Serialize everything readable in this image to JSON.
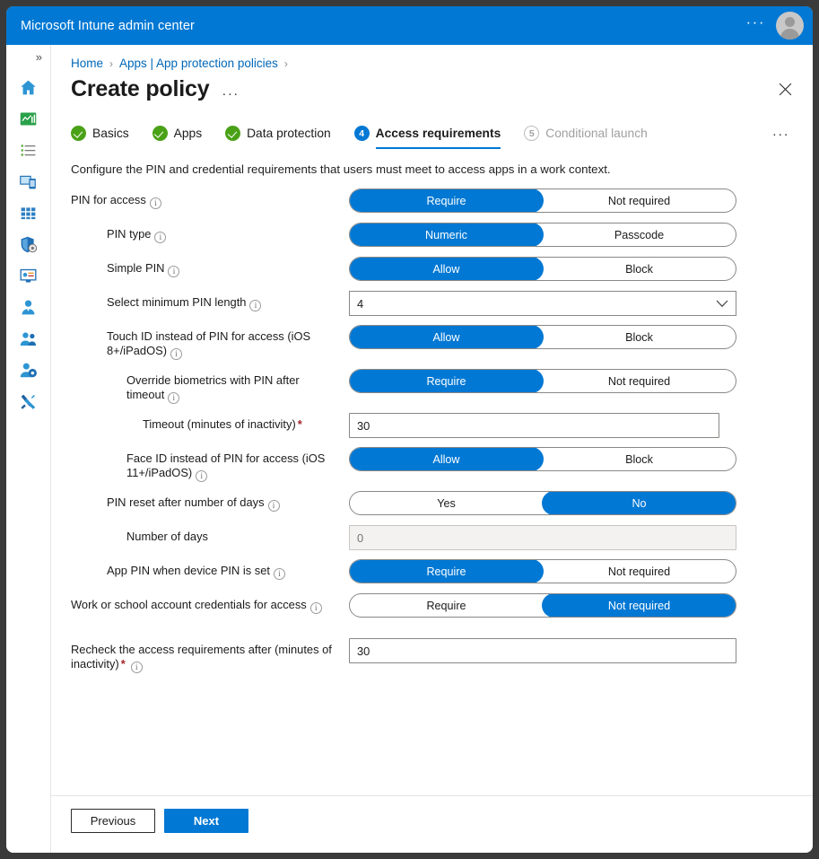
{
  "titlebar": {
    "app_title": "Microsoft Intune admin center",
    "ellipsis": "···",
    "avatar_name": "avatar"
  },
  "rail": {
    "toggle": "»",
    "icons": [
      "home-icon",
      "dashboard-icon",
      "all-services-icon",
      "devices-icon",
      "apps-icon",
      "endpoint-security-icon",
      "reports-icon",
      "users-icon",
      "groups-icon",
      "tenant-administration-icon",
      "troubleshooting-support-icon"
    ]
  },
  "breadcrumb": {
    "items": [
      "Home",
      "Apps | App protection policies"
    ],
    "separator": "›"
  },
  "header": {
    "title": "Create policy",
    "ellipsis": "···",
    "close": "✕"
  },
  "tabs": {
    "items": [
      {
        "label": "Basics",
        "state": "done",
        "num": "1"
      },
      {
        "label": "Apps",
        "state": "done",
        "num": "2"
      },
      {
        "label": "Data protection",
        "state": "done",
        "num": "3"
      },
      {
        "label": "Access requirements",
        "state": "active",
        "num": "4"
      },
      {
        "label": "Conditional launch",
        "state": "pending",
        "num": "5"
      }
    ],
    "ellipsis": "···"
  },
  "description": "Configure the PIN and credential requirements that users must meet to access apps in a work context.",
  "form": {
    "rows": [
      {
        "name": "pin-for-access",
        "label": "PIN for access",
        "indent": 0,
        "info": true,
        "required": false,
        "control": "toggle",
        "options": [
          "Require",
          "Not required"
        ],
        "selected": 0
      },
      {
        "name": "pin-type",
        "label": "PIN type",
        "indent": 1,
        "info": true,
        "required": false,
        "control": "toggle",
        "options": [
          "Numeric",
          "Passcode"
        ],
        "selected": 0
      },
      {
        "name": "simple-pin",
        "label": "Simple PIN",
        "indent": 1,
        "info": true,
        "required": false,
        "control": "toggle",
        "options": [
          "Allow",
          "Block"
        ],
        "selected": 0
      },
      {
        "name": "select-minimum-pin-length",
        "label": "Select minimum PIN length",
        "indent": 1,
        "info": true,
        "required": false,
        "control": "select",
        "value": "4"
      },
      {
        "name": "touch-id-instead-of-pin",
        "label": "Touch ID instead of PIN for access (iOS 8+/iPadOS)",
        "indent": 1,
        "info": true,
        "required": false,
        "control": "toggle",
        "options": [
          "Allow",
          "Block"
        ],
        "selected": 0
      },
      {
        "name": "override-biometrics-with-pin-after-timeout",
        "label": "Override biometrics with PIN after timeout",
        "indent": 2,
        "info": true,
        "required": false,
        "control": "toggle",
        "options": [
          "Require",
          "Not required"
        ],
        "selected": 0
      },
      {
        "name": "timeout-minutes-of-inactivity",
        "label": "Timeout (minutes of inactivity)",
        "indent": 3,
        "info": false,
        "required": true,
        "control": "text",
        "value": "30",
        "narrow": true,
        "disabled": false
      },
      {
        "name": "face-id-instead-of-pin",
        "label": "Face ID instead of PIN for access (iOS 11+/iPadOS)",
        "indent": 2,
        "info": true,
        "required": false,
        "control": "toggle",
        "options": [
          "Allow",
          "Block"
        ],
        "selected": 0
      },
      {
        "name": "pin-reset-after-number-of-days",
        "label": "PIN reset after number of days",
        "indent": 1,
        "info": true,
        "required": false,
        "control": "toggle",
        "options": [
          "Yes",
          "No"
        ],
        "selected": 1
      },
      {
        "name": "number-of-days",
        "label": "Number of days",
        "indent": 2,
        "info": false,
        "required": false,
        "control": "text",
        "value": "",
        "placeholder": "0",
        "disabled": true
      },
      {
        "name": "app-pin-when-device-pin-is-set",
        "label": "App PIN when device PIN is set",
        "indent": 1,
        "info": true,
        "required": false,
        "control": "toggle",
        "options": [
          "Require",
          "Not required"
        ],
        "selected": 0
      },
      {
        "name": "work-or-school-account-credentials-for-access",
        "label": "Work or school account credentials for access",
        "indent": 0,
        "info": true,
        "required": false,
        "control": "toggle",
        "options": [
          "Require",
          "Not required"
        ],
        "selected": 1
      },
      {
        "name": "recheck-the-access-requirements-after",
        "label": "Recheck the access requirements after (minutes of inactivity)",
        "indent": 0,
        "info": true,
        "required": true,
        "control": "text",
        "value": "30",
        "disabled": false
      }
    ]
  },
  "footer": {
    "previous_label": "Previous",
    "next_label": "Next"
  },
  "colors": {
    "brand_blue": "#0078d4",
    "link_blue": "#0067b8",
    "check_green": "#4aa117",
    "required_red": "#a4262c"
  }
}
